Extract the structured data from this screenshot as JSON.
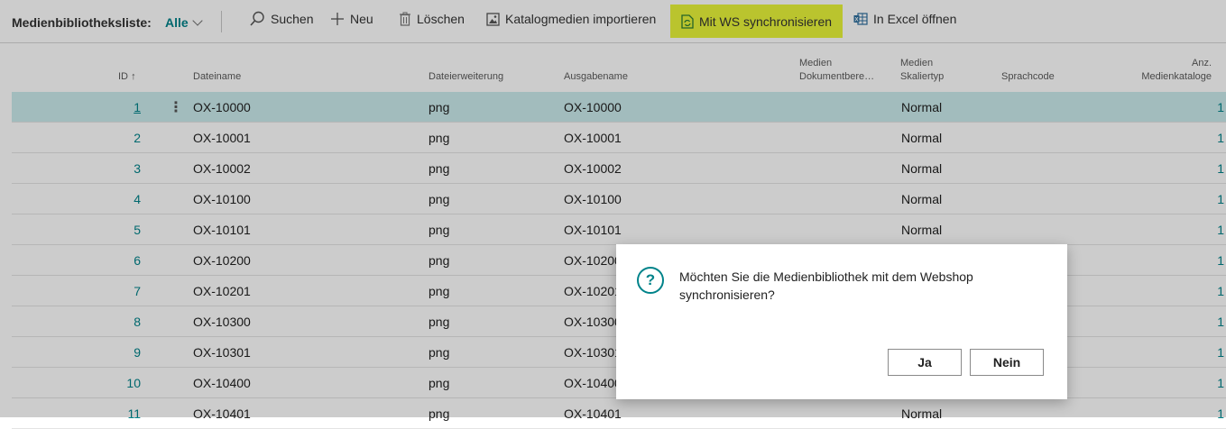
{
  "toolbar": {
    "page_title": "Medienbibliotheksliste:",
    "filter_label": "Alle",
    "actions": [
      {
        "label": "Suchen",
        "icon": "search-icon"
      },
      {
        "label": "Neu",
        "icon": "plus-icon"
      },
      {
        "label": "Löschen",
        "icon": "trash-icon"
      },
      {
        "label": "Katalogmedien importieren",
        "icon": "image-import-icon"
      },
      {
        "label": "Mit WS synchronisieren",
        "icon": "sync-document-icon",
        "highlight_color": "#e9f53a"
      },
      {
        "label": "In Excel öffnen",
        "icon": "excel-icon"
      }
    ]
  },
  "table": {
    "headers": {
      "id": "ID",
      "sort_indicator": "↑",
      "file_name": "Dateiname",
      "extension": "Dateierweiterung",
      "output_name": "Ausgabename",
      "media_doc_1": "Medien",
      "media_doc_2": "Dokumentbere…",
      "media_scale_1": "Medien",
      "media_scale_2": "Skaliertyp",
      "language": "Sprachcode",
      "catalog_count_1": "Anz.",
      "catalog_count_2": "Medienkataloge"
    },
    "rows": [
      {
        "id": "1",
        "file": "OX-10000",
        "ext": "png",
        "out": "OX-10000",
        "scale": "Normal",
        "count": "1",
        "selected": true
      },
      {
        "id": "2",
        "file": "OX-10001",
        "ext": "png",
        "out": "OX-10001",
        "scale": "Normal",
        "count": "1"
      },
      {
        "id": "3",
        "file": "OX-10002",
        "ext": "png",
        "out": "OX-10002",
        "scale": "Normal",
        "count": "1"
      },
      {
        "id": "4",
        "file": "OX-10100",
        "ext": "png",
        "out": "OX-10100",
        "scale": "Normal",
        "count": "1"
      },
      {
        "id": "5",
        "file": "OX-10101",
        "ext": "png",
        "out": "OX-10101",
        "scale": "Normal",
        "count": "1"
      },
      {
        "id": "6",
        "file": "OX-10200",
        "ext": "png",
        "out": "OX-10200",
        "scale": "",
        "count": "1"
      },
      {
        "id": "7",
        "file": "OX-10201",
        "ext": "png",
        "out": "OX-10201",
        "scale": "",
        "count": "1"
      },
      {
        "id": "8",
        "file": "OX-10300",
        "ext": "png",
        "out": "OX-10300",
        "scale": "",
        "count": "1"
      },
      {
        "id": "9",
        "file": "OX-10301",
        "ext": "png",
        "out": "OX-10301",
        "scale": "",
        "count": "1"
      },
      {
        "id": "10",
        "file": "OX-10400",
        "ext": "png",
        "out": "OX-10400",
        "scale": "",
        "count": "1"
      },
      {
        "id": "11",
        "file": "OX-10401",
        "ext": "png",
        "out": "OX-10401",
        "scale": "Normal",
        "count": "1"
      }
    ]
  },
  "dialog": {
    "icon": "question-icon",
    "message": "Möchten Sie die Medienbibliothek mit dem Webshop synchronisieren?",
    "yes_label": "Ja",
    "no_label": "Nein"
  },
  "colors": {
    "accent": "#00838a",
    "selected_row": "#cbeced",
    "highlight": "#e9f53a"
  }
}
